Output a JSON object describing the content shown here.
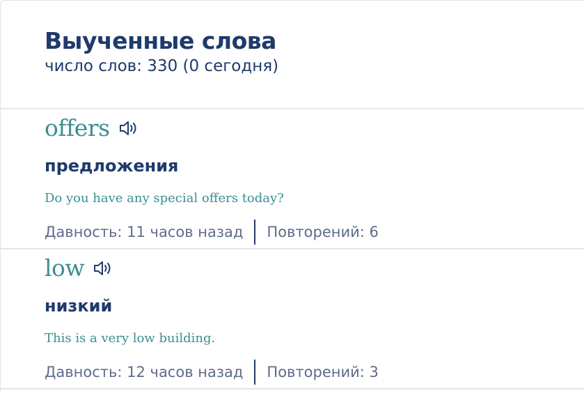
{
  "header": {
    "title": "Выученные слова",
    "count_text": "число слов: 330 (0 сегодня)"
  },
  "words": [
    {
      "word": "offers",
      "translation": "предложения",
      "example": "Do you have any special offers today?",
      "age": "Давность: 11 часов назад",
      "repeats": "Повторений: 6"
    },
    {
      "word": "low",
      "translation": "низкий",
      "example": "This is a very low building.",
      "age": "Давность: 12 часов назад",
      "repeats": "Повторений: 3"
    }
  ],
  "icons": {
    "speaker": "speaker-icon"
  },
  "colors": {
    "title": "#1f3a6b",
    "word": "#3a8f92",
    "meta": "#5e6c8a"
  }
}
